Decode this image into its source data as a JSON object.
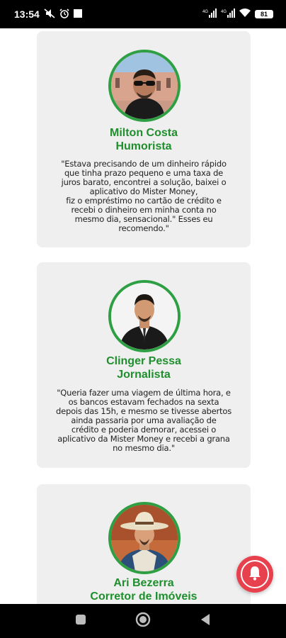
{
  "status_bar": {
    "time": "13:54",
    "battery": "81",
    "net_label_1": "4G",
    "net_label_2": "4G"
  },
  "testimonials": [
    {
      "name": "Milton Costa",
      "role": "Humorista",
      "quote_lines": [
        "\"Estava precisando de um dinheiro rápido",
        "que tinha prazo pequeno e uma taxa de",
        "juros barato, encontrei a solução, baixei o",
        "aplicativo do Mister Money,",
        "fiz o empréstimo no cartão de crédito e",
        "recebi o dinheiro em minha conta no",
        "mesmo dia, sensacional.\" Esses eu",
        "recomendo.\""
      ]
    },
    {
      "name": "Clinger Pessa",
      "role": "Jornalista",
      "quote_lines": [
        "\"Queria fazer uma viagem de última hora, e",
        "os bancos estavam fechados na sexta",
        "depois das 15h, e mesmo se tivesse abertos",
        "ainda passaria por uma avaliação de",
        "crédito e poderia demorar, acessei o",
        "aplicativo da Mister Money e recebi a grana",
        "no mesmo dia.\""
      ]
    },
    {
      "name": "Ari Bezerra",
      "role": "Corretor de Imóveis",
      "quote_lines": []
    }
  ],
  "colors": {
    "accent_green": "#1f8f2e",
    "avatar_border": "#2ea043",
    "card_bg": "#efefef",
    "fab_red": "#e8414e"
  },
  "icons": {
    "notification_fab": "bell-icon",
    "nav_recents": "square-icon",
    "nav_home": "circle-icon",
    "nav_back": "triangle-back-icon"
  }
}
